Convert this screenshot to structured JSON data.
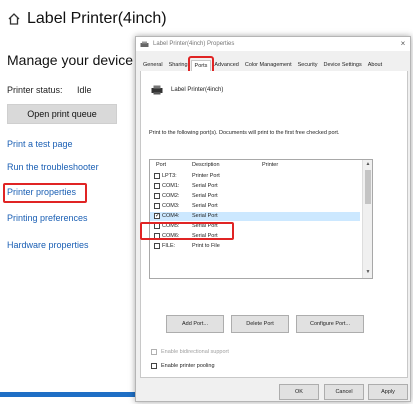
{
  "header": {
    "title": "Label Printer(4inch)",
    "icon": "home-icon"
  },
  "sidebar": {
    "manage_title": "Manage your device",
    "status_label": "Printer status:",
    "status_value": "Idle",
    "open_queue": "Open print queue",
    "links": [
      "Print a test page",
      "Run the troubleshooter",
      "Printer properties",
      "Printing preferences",
      "Hardware properties"
    ]
  },
  "dialog": {
    "title": "Label Printer(4inch) Properties",
    "close": "×",
    "tabs": [
      "General",
      "Sharing",
      "Ports",
      "Advanced",
      "Color Management",
      "Security",
      "Device Settings",
      "About"
    ],
    "active_tab": "Ports",
    "printer_name": "Label Printer(4inch)",
    "description": "Print to the following port(s). Documents will print to the first free checked port.",
    "columns": {
      "port": "Port",
      "description": "Description",
      "printer": "Printer"
    },
    "ports": [
      {
        "port": "LPT3:",
        "description": "Printer Port",
        "checked": false
      },
      {
        "port": "COM1:",
        "description": "Serial Port",
        "checked": false
      },
      {
        "port": "COM2:",
        "description": "Serial Port",
        "checked": false
      },
      {
        "port": "COM3:",
        "description": "Serial Port",
        "checked": false
      },
      {
        "port": "COM4:",
        "description": "Serial Port",
        "checked": true
      },
      {
        "port": "COM5:",
        "description": "Serial Port",
        "checked": false
      },
      {
        "port": "COM6:",
        "description": "Serial Port",
        "checked": false
      },
      {
        "port": "FILE:",
        "description": "Print to File",
        "checked": false
      }
    ],
    "buttons": {
      "add_port": "Add Port...",
      "delete_port": "Delete Port",
      "configure_port": "Configure Port..."
    },
    "bidirectional": "Enable bidirectional support",
    "pooling": "Enable printer pooling",
    "footer": {
      "ok": "OK",
      "cancel": "Cancel",
      "apply": "Apply"
    }
  },
  "colors": {
    "highlight": "#e02424",
    "link": "#1a5fb4",
    "selection": "#cce8ff",
    "taskbar": "#1f6fc5"
  }
}
